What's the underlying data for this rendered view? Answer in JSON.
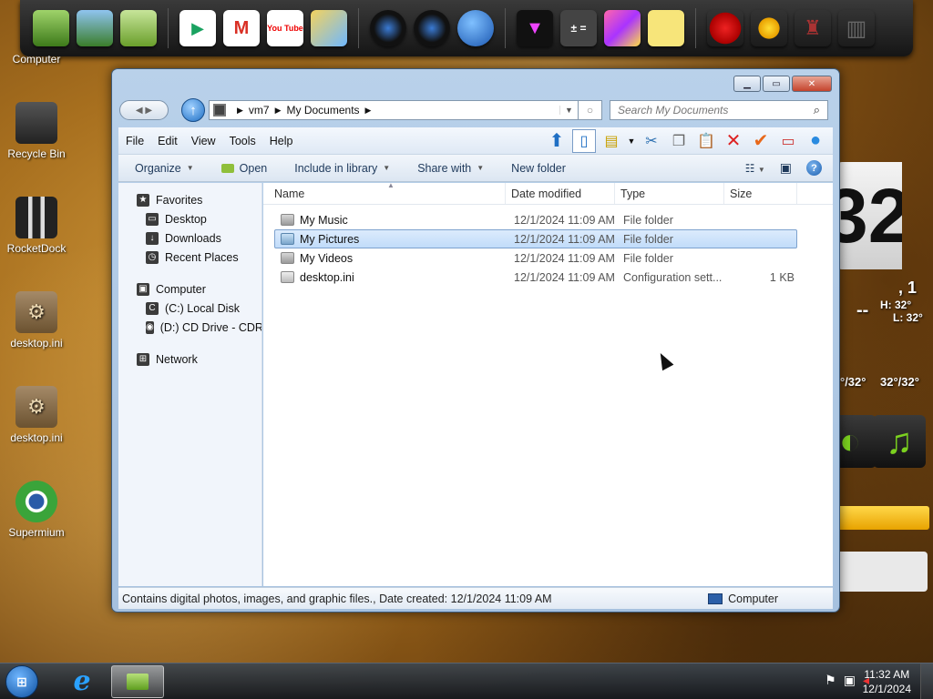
{
  "desktop": {
    "icons": [
      {
        "label": "Computer"
      },
      {
        "label": "Recycle Bin"
      },
      {
        "label": "RocketDock"
      },
      {
        "label": "desktop.ini"
      },
      {
        "label": "desktop.ini"
      },
      {
        "label": "Supermium"
      }
    ]
  },
  "dock": {
    "youtube_text": "You Tube",
    "gmail_text": "M"
  },
  "widgets": {
    "clock_digits": "32",
    "date_text": ", 1",
    "temp_high": "H:  32°",
    "temp_low": "L:  32°",
    "dash": "--",
    "forecast_1": "°/32°",
    "forecast_2": "32°/32°"
  },
  "window": {
    "address": {
      "crumbs": [
        "vm7",
        "My Documents"
      ]
    },
    "search": {
      "placeholder": "Search My Documents"
    },
    "menu": [
      "File",
      "Edit",
      "View",
      "Tools",
      "Help"
    ],
    "commands": {
      "organize": "Organize",
      "open": "Open",
      "include": "Include in library",
      "share": "Share with",
      "new_folder": "New folder"
    },
    "nav": {
      "favorites": "Favorites",
      "desktop": "Desktop",
      "downloads": "Downloads",
      "recent": "Recent Places",
      "computer": "Computer",
      "local_disk": "(C:) Local Disk",
      "cd_drive": "(D:) CD Drive - CDROM",
      "network": "Network"
    },
    "columns": {
      "name": "Name",
      "date": "Date modified",
      "type": "Type",
      "size": "Size"
    },
    "files": [
      {
        "name": "My Music",
        "date": "12/1/2024 11:09 AM",
        "type": "File folder",
        "size": ""
      },
      {
        "name": "My Pictures",
        "date": "12/1/2024 11:09 AM",
        "type": "File folder",
        "size": ""
      },
      {
        "name": "My Videos",
        "date": "12/1/2024 11:09 AM",
        "type": "File folder",
        "size": ""
      },
      {
        "name": "desktop.ini",
        "date": "12/1/2024 11:09 AM",
        "type": "Configuration sett...",
        "size": "1 KB"
      }
    ],
    "selected_index": 1,
    "status": {
      "text": "Contains digital photos, images, and graphic files., Date created: 12/1/2024 11:09 AM",
      "location": "Computer"
    }
  },
  "taskbar": {
    "time": "11:32 AM",
    "date": "12/1/2024"
  }
}
